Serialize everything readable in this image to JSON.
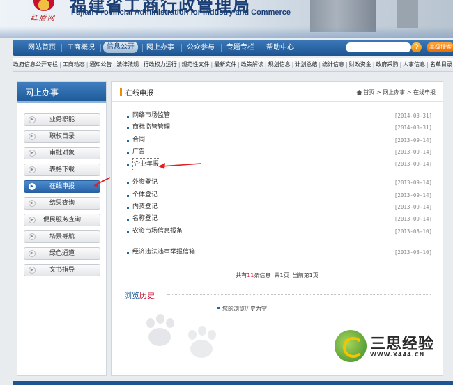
{
  "banner": {
    "site_name": "红盾网",
    "title_cn": "福建省工商行政管理局",
    "title_en": "Fujian Provincial Administration for Industry and Commerce"
  },
  "nav": {
    "items": [
      {
        "label": "网站首页"
      },
      {
        "label": "工商概况"
      },
      {
        "label": "信息公开"
      },
      {
        "label": "网上办事"
      },
      {
        "label": "公众参与"
      },
      {
        "label": "专题专栏"
      },
      {
        "label": "帮助中心"
      }
    ],
    "active_index": 2,
    "search_placeholder": "",
    "search_icon": "search-icon",
    "advanced_search": "高级搜索"
  },
  "subnav": {
    "items": [
      "政府信息公开专栏",
      "工商动态",
      "通知公告",
      "法律法规",
      "行政权力运行",
      "规范性文件",
      "最新文件",
      "政策解读",
      "规划信息",
      "计划总结",
      "统计信息",
      "财政资金",
      "政府采购",
      "人事信息",
      "名单目录"
    ]
  },
  "sidebar": {
    "title": "网上办事",
    "items": [
      {
        "label": "业务职能"
      },
      {
        "label": "职权目录"
      },
      {
        "label": "审批对象"
      },
      {
        "label": "表格下载"
      },
      {
        "label": "在线申报"
      },
      {
        "label": "结果查询"
      },
      {
        "label": "便民服务查询"
      },
      {
        "label": "场景导航"
      },
      {
        "label": "绿色通道"
      },
      {
        "label": "文书指导"
      }
    ],
    "active_index": 4
  },
  "main": {
    "title": "在线申报",
    "breadcrumb": {
      "home": "首页",
      "sep": ">",
      "level1": "网上办事",
      "level2": "在线申报"
    },
    "list": [
      {
        "title": "网络市场监管",
        "date": "[2014-03-31]"
      },
      {
        "title": "商标监管管理",
        "date": "[2014-03-31]"
      },
      {
        "title": "合同",
        "date": "[2013-09-14]"
      },
      {
        "title": "广告",
        "date": "[2013-09-14]"
      },
      {
        "title": "企业年报",
        "date": "[2013-09-14]"
      },
      {
        "title": "外资登记",
        "date": "[2013-09-14]"
      },
      {
        "title": "个体登记",
        "date": "[2013-09-14]"
      },
      {
        "title": "内资登记",
        "date": "[2013-09-14]"
      },
      {
        "title": "名称登记",
        "date": "[2013-09-14]"
      },
      {
        "title": "农资市场信息报备",
        "date": "[2013-08-10]"
      },
      {
        "title": "经济违法违章举报信箱",
        "date": "[2013-08-10]"
      }
    ],
    "pager": {
      "total_prefix": "共有",
      "total_count": "11",
      "total_suffix": "条信息",
      "pages": "共1页",
      "current": "当前第1页"
    },
    "history": {
      "title_a": "浏览",
      "title_b": "历史",
      "empty_text": "您的浏览历史为空"
    }
  },
  "watermark": {
    "text": "三思经验",
    "url": "WWW.X444.CN"
  },
  "colors": {
    "nav_blue": "#1d5592",
    "accent_orange": "#f08a00",
    "history_red": "#c8102e"
  }
}
